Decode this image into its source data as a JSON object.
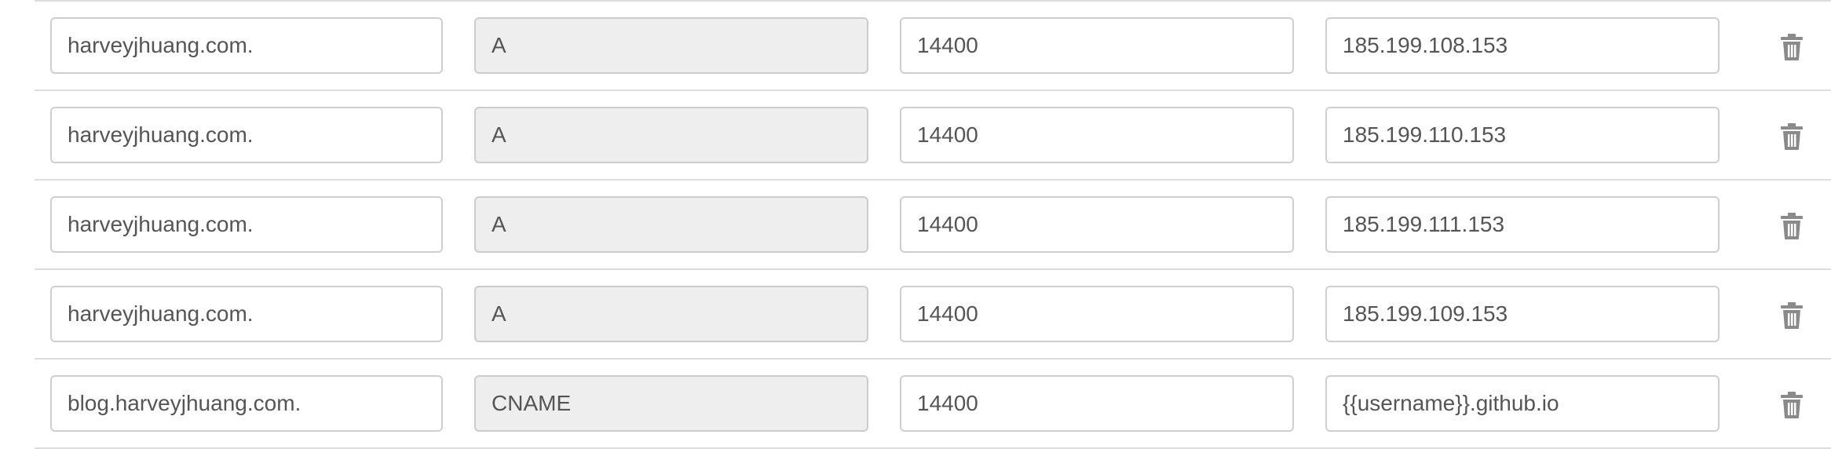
{
  "records": [
    {
      "name": "harveyjhuang.com.",
      "type": "A",
      "ttl": "14400",
      "value": "185.199.108.153",
      "delete_icon": "trash-icon"
    },
    {
      "name": "harveyjhuang.com.",
      "type": "A",
      "ttl": "14400",
      "value": "185.199.110.153",
      "delete_icon": "trash-icon"
    },
    {
      "name": "harveyjhuang.com.",
      "type": "A",
      "ttl": "14400",
      "value": "185.199.111.153",
      "delete_icon": "trash-icon"
    },
    {
      "name": "harveyjhuang.com.",
      "type": "A",
      "ttl": "14400",
      "value": "185.199.109.153",
      "delete_icon": "trash-icon"
    },
    {
      "name": "blog.harveyjhuang.com.",
      "type": "CNAME",
      "ttl": "14400",
      "value": "{{username}}.github.io",
      "delete_icon": "trash-icon"
    }
  ],
  "colors": {
    "border": "#cfcfcf",
    "readonly_bg": "#eeeeee",
    "row_divider": "#dddddd",
    "text": "#555555",
    "icon": "#8a8a8a"
  }
}
